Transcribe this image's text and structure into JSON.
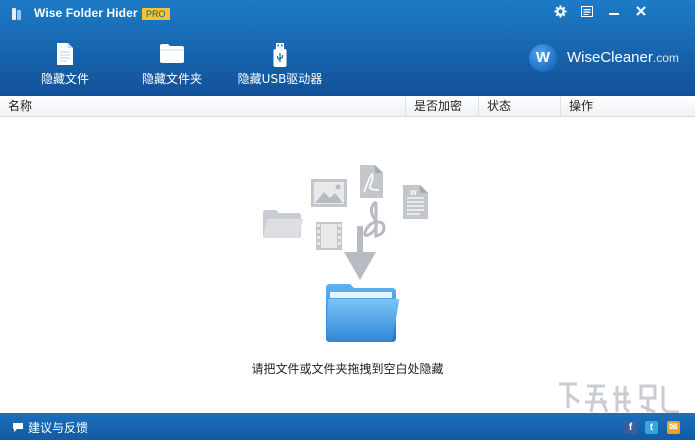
{
  "app": {
    "title": "Wise Folder Hider",
    "edition": "PRO"
  },
  "window_controls": [
    "gear-icon",
    "settings-icon",
    "minimize-icon",
    "close-icon"
  ],
  "toolbar": {
    "hide_file_label": "隐藏文件",
    "hide_folder_label": "隐藏文件夹",
    "hide_usb_label": "隐藏USB驱动器"
  },
  "brand": {
    "logo_letter": "W",
    "name": "WiseCleaner",
    "domain": ".com"
  },
  "columns": {
    "name": "名称",
    "encrypted": "是否加密",
    "status": "状态",
    "action": "操作"
  },
  "content": {
    "drop_hint": "请把文件或文件夹拖拽到空白处隐藏"
  },
  "statusbar": {
    "feedback_label": "建议与反馈",
    "social": [
      "f",
      "t",
      "✉"
    ]
  },
  "colors": {
    "header_top": "#1d7bc7",
    "header_bottom": "#125199",
    "pro_badge": "#f4c232",
    "statusbar": "#1665ad",
    "folder_blue": "#3b93dc"
  }
}
